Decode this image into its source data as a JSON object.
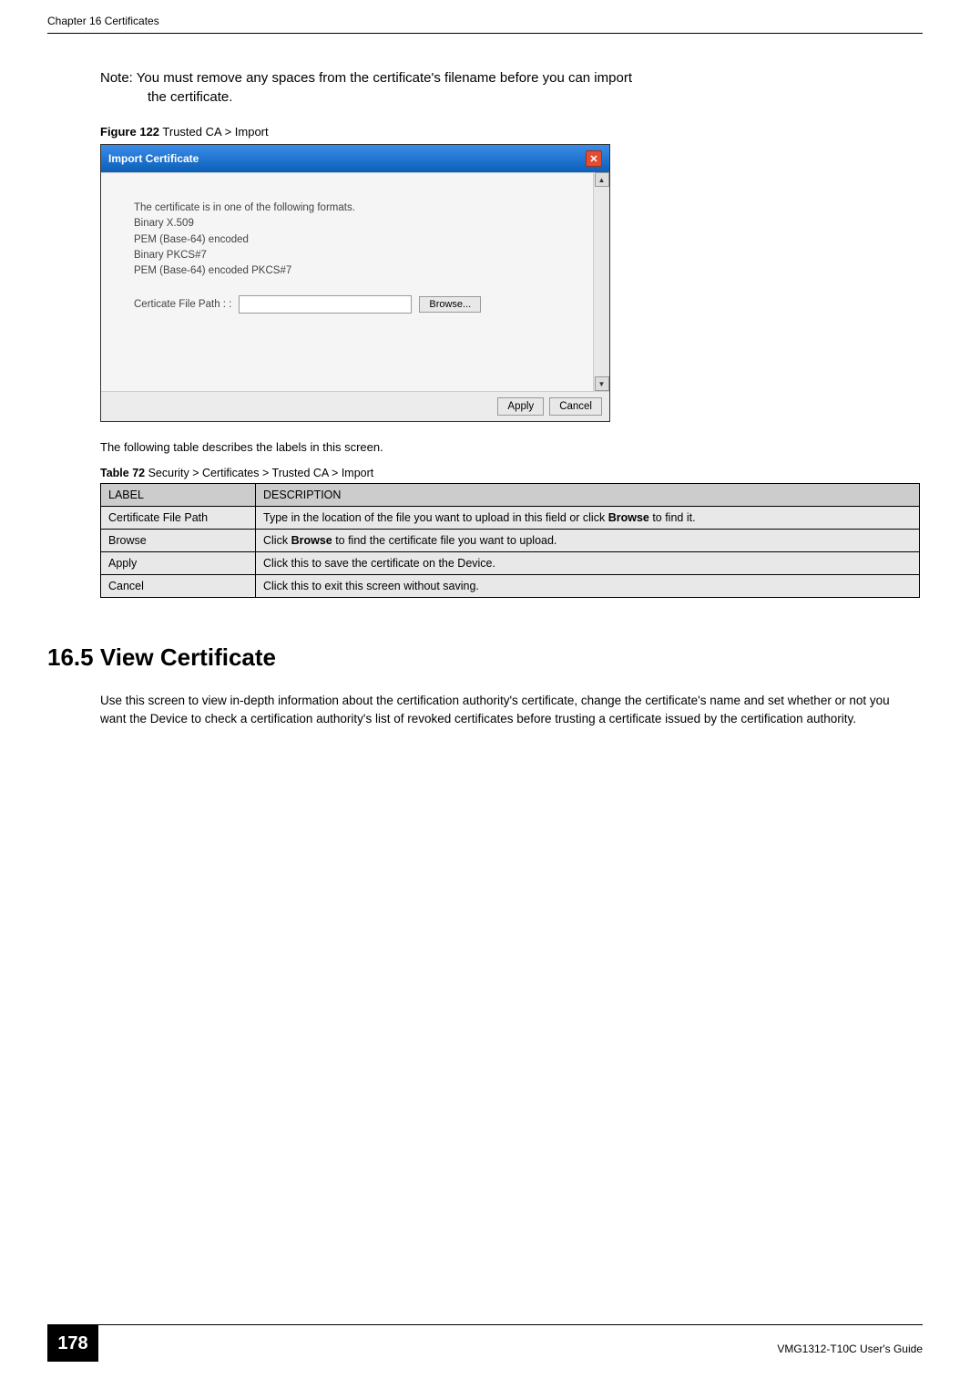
{
  "header": {
    "left": "Chapter 16 Certificates"
  },
  "note": {
    "prefix": "Note: ",
    "line1": "You must remove any spaces from the certificate's filename before you can import",
    "line2": "the certificate."
  },
  "figure": {
    "label": "Figure 122",
    "caption": "   Trusted CA > Import"
  },
  "dialog": {
    "title": "Import Certificate",
    "formats_intro": "The certificate is in one of the following formats.",
    "format1": "Binary X.509",
    "format2": "PEM (Base-64) encoded",
    "format3": "Binary PKCS#7",
    "format4": "PEM (Base-64) encoded PKCS#7",
    "filepath_label": "Certicate File Path : :",
    "browse_btn": "Browse...",
    "apply_btn": "Apply",
    "cancel_btn": "Cancel"
  },
  "table_intro": "The following table describes the labels in this screen.",
  "table": {
    "label": "Table 72",
    "caption": "   Security > Certificates > Trusted CA > Import",
    "header_label": "LABEL",
    "header_desc": "DESCRIPTION",
    "rows": [
      {
        "label": "Certificate File Path",
        "desc_pre": "Type in the location of the file you want to upload in this field or click ",
        "desc_bold": "Browse",
        "desc_post": " to find it."
      },
      {
        "label": "Browse",
        "desc_pre": "Click ",
        "desc_bold": "Browse",
        "desc_post": " to find the certificate file you want to upload."
      },
      {
        "label": "Apply",
        "desc_pre": "Click this to save the certificate on the Device.",
        "desc_bold": "",
        "desc_post": ""
      },
      {
        "label": "Cancel",
        "desc_pre": "Click this to exit this screen without saving.",
        "desc_bold": "",
        "desc_post": ""
      }
    ]
  },
  "section": {
    "heading": "16.5  View Certificate",
    "body": "Use this screen to view in-depth information about the certification authority's certificate, change the certificate's name and set whether or not you want the Device to check a certification authority's list of revoked certificates before trusting a certificate issued by the certification authority."
  },
  "footer": {
    "page": "178",
    "guide": "VMG1312-T10C User's Guide"
  }
}
